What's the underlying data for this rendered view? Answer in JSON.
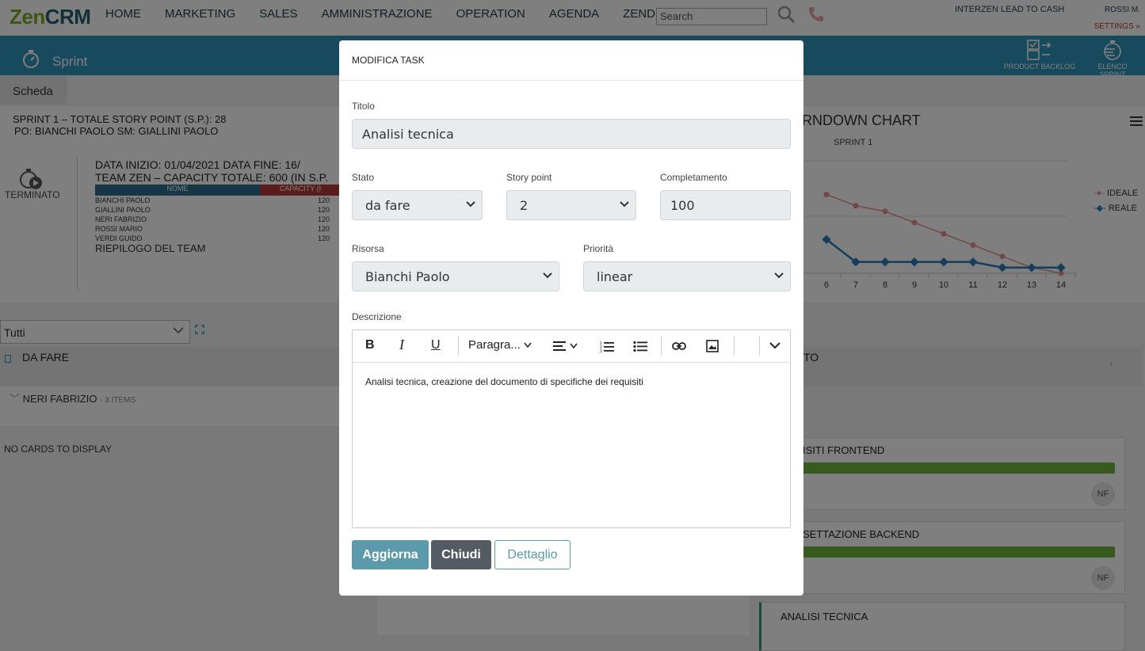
{
  "nav": {
    "logo_zen": "Zen",
    "logo_crm": "CRM",
    "menu": [
      "HOME",
      "MARKETING",
      "SALES",
      "AMMINISTRAZIONE",
      "OPERATION",
      "AGENDA",
      "ZENDMS"
    ],
    "search_placeholder": "Search",
    "lead_to_cash": "INTERZEN LEAD TO CASH",
    "user": "ROSSI M.",
    "settings": "SETTINGS »"
  },
  "sprintbar": {
    "title": "Sprint",
    "product_backlog": "PRODUCT BACKLOG",
    "elenco_sprint": "ELENCO SPRINT"
  },
  "scheda": {
    "tab": "Scheda",
    "line1": "SPRINT 1 – TOTALE STORY POINT (S.P.): 28",
    "line2": "PO: BIANCHI PAOLO  SM: GIALLINI PAOLO",
    "status": "TERMINATO",
    "dates": "DATA INIZIO: 01/04/2021  DATA FINE: 16/",
    "team": "TEAM ZEN – CAPACITY TOTALE: 600 (IN S.P.",
    "team_col_name": "NOME",
    "team_col_capacity": "CAPACITY (I",
    "team_rows": [
      {
        "name": "BIANCHI PAOLO",
        "capacity": "120"
      },
      {
        "name": "GIALLINI PAOLO",
        "capacity": "120"
      },
      {
        "name": "NERI FABRIZIO",
        "capacity": "120"
      },
      {
        "name": "ROSSI MARIO",
        "capacity": "120"
      },
      {
        "name": "VERDI GUIDO",
        "capacity": "120"
      }
    ],
    "riepilogo": "RIEPILOGO DEL TEAM"
  },
  "board": {
    "filter": "Tutti",
    "col_dafare": "DA FARE",
    "group_name": "NERI FABRIZIO",
    "group_count": "- 3 ITEMS",
    "no_cards": "NO CARDS TO DISPLAY",
    "right_col": "TO",
    "cards": [
      {
        "title": "ISITI FRONTEND",
        "avatar": "NF"
      },
      {
        "title": "SETTAZIONE BACKEND",
        "avatar": "NF"
      },
      {
        "title": "ANALISI TECNICA"
      }
    ]
  },
  "chart": {
    "title": "RNDOWN CHART",
    "subtitle": "SPRINT 1",
    "legend_ideale": "IDEALE",
    "legend_reale": "REALE",
    "ticks": [
      "6",
      "7",
      "8",
      "9",
      "10",
      "11",
      "12",
      "13",
      "14"
    ]
  },
  "chart_data": {
    "type": "line",
    "title": "BURNDOWN CHART",
    "subtitle": "SPRINT 1",
    "x": [
      6,
      7,
      8,
      9,
      10,
      11,
      12,
      13,
      14
    ],
    "series": [
      {
        "name": "IDEALE",
        "values": [
          14,
          12,
          11,
          9,
          7,
          5,
          3,
          1,
          0
        ]
      },
      {
        "name": "REALE",
        "values": [
          6,
          2,
          2,
          2,
          2,
          2,
          1,
          1,
          1
        ]
      }
    ],
    "colors": {
      "IDEALE": "#e88f8f",
      "REALE": "#2a7ab8"
    }
  },
  "modal": {
    "header": "MODIFICA TASK",
    "titolo_label": "Titolo",
    "titolo_value": "Analisi tecnica",
    "stato_label": "Stato",
    "stato_value": "da fare",
    "sp_label": "Story point",
    "sp_value": "2",
    "compl_label": "Completamento",
    "compl_value": "100",
    "risorsa_label": "Risorsa",
    "risorsa_value": "Bianchi Paolo",
    "priorita_label": "Priorità",
    "priorita_value": "linear",
    "descr_label": "Descrizione",
    "paragraph": "Paragra...",
    "descr_text": "Analisi tecnica, creazione del documento di specifiche dei requisiti",
    "btn_aggiorna": "Aggiorna",
    "btn_chiudi": "Chiudi",
    "btn_dettaglio": "Dettaglio"
  }
}
